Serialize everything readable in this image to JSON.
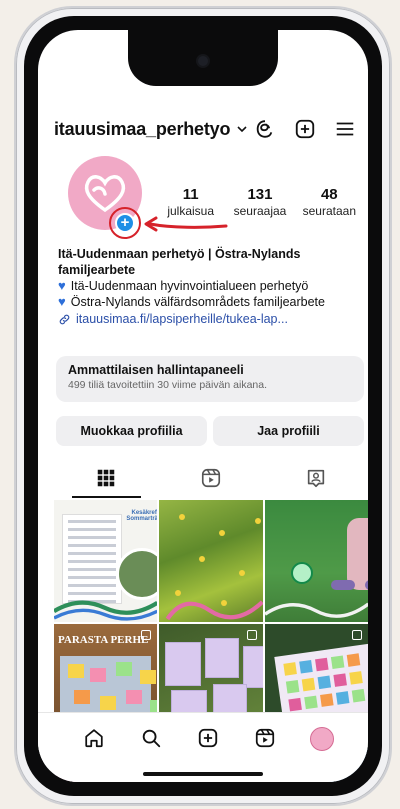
{
  "header": {
    "username": "itauusimaa_perhetyo"
  },
  "profile": {
    "stats": [
      {
        "num": "11",
        "label": "julkaisua"
      },
      {
        "num": "131",
        "label": "seuraajaa"
      },
      {
        "num": "48",
        "label": "seurataan"
      }
    ],
    "bio_name": "Itä-Uudenmaan perhetyö | Östra-Nylands familjearbete",
    "bio_lines": [
      "Itä-Uudenmaan hyvinvointialueen perhetyö",
      "Östra-Nylands välfärdsområdets familjearbete"
    ],
    "link": "itauusimaa.fi/lapsiperheille/tukea-lap..."
  },
  "dashboard": {
    "title": "Ammattilaisen hallintapaneeli",
    "subtitle": "499 tiliä tavoitettiin 30 viime päivän aikana."
  },
  "buttons": {
    "edit": "Muokkaa profiilia",
    "share": "Jaa profiili"
  },
  "posts": {
    "p1_title": "Kesäkreffit! Sommarträffar!",
    "p4_banner": "PARASTA PERHE"
  },
  "colors": {
    "accent": "#1f8fe6",
    "avatar": "#f1a9c6",
    "annotation": "#d6222a"
  }
}
